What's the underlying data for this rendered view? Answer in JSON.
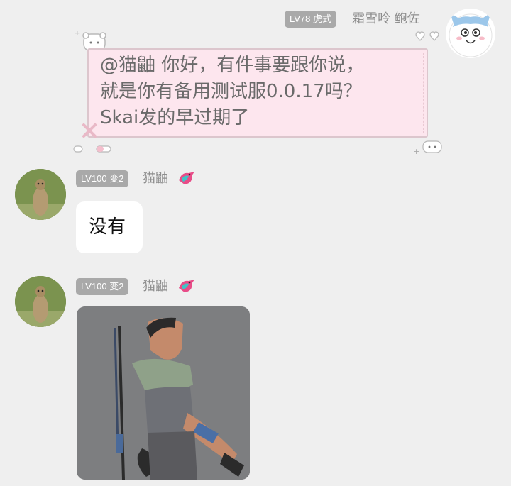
{
  "top_message": {
    "level_badge": "LV78 虎式",
    "sender_name": "霜雪呤 鲍佐",
    "text_lines": [
      "@猫鼬 你好，有件事要跟你说，",
      "就是你有备用测试服0.0.17吗？",
      "Skai发的早过期了"
    ]
  },
  "reply_1": {
    "level_badge": "LV100 变2",
    "sender_name": "猫鼬",
    "text": "没有"
  },
  "reply_2": {
    "level_badge": "LV100 变2",
    "sender_name": "猫鼬"
  },
  "icons": [
    "cat-avatar",
    "meerkat-avatar",
    "bird-badge-icon",
    "pixel-heart-icon"
  ],
  "colors": {
    "background": "#efefef",
    "badge": "#a9a9a9",
    "pink_bubble": "#fde6ee"
  }
}
